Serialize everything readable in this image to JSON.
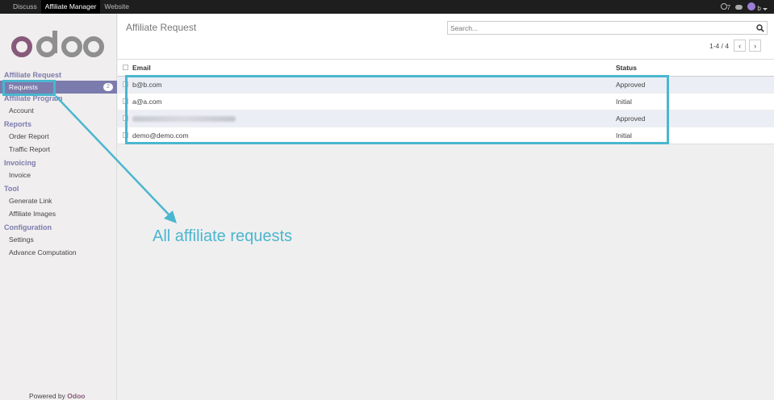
{
  "topbar": {
    "nav": [
      "Discuss",
      "Affiliate Manager",
      "Website"
    ],
    "active_index": 1,
    "notifications": "7",
    "user": "b"
  },
  "sidebar": {
    "logo_text": "odoo",
    "sections": [
      {
        "title": "Affiliate Request",
        "items": [
          {
            "label": "Requests",
            "badge": "2",
            "active": true
          }
        ]
      },
      {
        "title": "Affiliate Program",
        "items": [
          {
            "label": "Account"
          }
        ]
      },
      {
        "title": "Reports",
        "items": [
          {
            "label": "Order Report"
          },
          {
            "label": "Traffic Report"
          }
        ]
      },
      {
        "title": "Invoicing",
        "items": [
          {
            "label": "Invoice"
          }
        ]
      },
      {
        "title": "Tool",
        "items": [
          {
            "label": "Generate Link"
          },
          {
            "label": "Affiliate Images"
          }
        ]
      },
      {
        "title": "Configuration",
        "items": [
          {
            "label": "Settings"
          },
          {
            "label": "Advance Computation"
          }
        ]
      }
    ],
    "powered_by": "Powered by",
    "powered_brand": "Odoo"
  },
  "main": {
    "title": "Affiliate Request",
    "search_placeholder": "Search...",
    "pager": "1-4 / 4",
    "columns": [
      "Email",
      "Status"
    ],
    "rows": [
      {
        "email": "b@b.com",
        "status": "Approved"
      },
      {
        "email": "a@a.com",
        "status": "Initial"
      },
      {
        "email": "",
        "status": "Approved",
        "blurred": true
      },
      {
        "email": "demo@demo.com",
        "status": "Initial"
      }
    ]
  },
  "annotation": {
    "text": "All affiliate requests",
    "color": "#4bb6cf"
  },
  "colors": {
    "accent": "#7c7bad",
    "brand": "#875a7b",
    "topbar": "#1e1e1e"
  }
}
